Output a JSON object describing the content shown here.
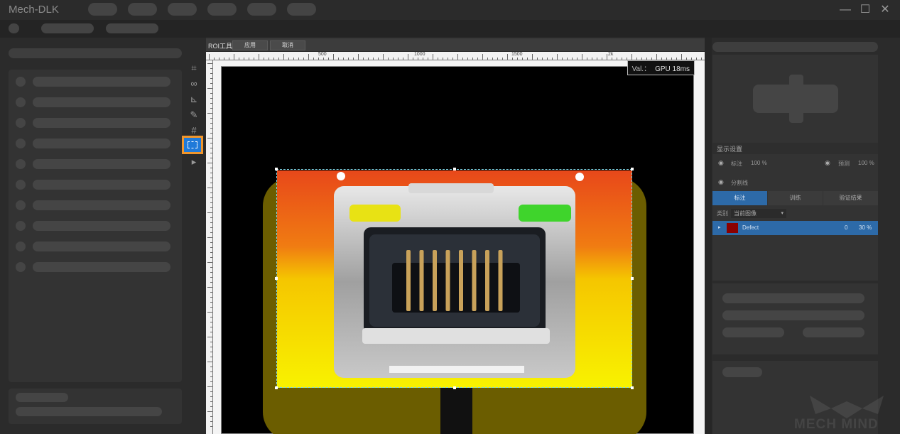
{
  "app": {
    "title": "Mech-DLK",
    "window_controls": [
      "minimize-icon",
      "maximize-icon",
      "close-icon"
    ]
  },
  "canvas": {
    "roi_tool_label": "ROI工具",
    "apply_button": "应用",
    "cancel_button": "取消",
    "ruler_labels": [
      "500",
      "1000",
      "1500",
      "2k"
    ],
    "val_label": "Val.：",
    "val_value": "GPU 18ms"
  },
  "tools": [
    {
      "icon": "crop-icon"
    },
    {
      "icon": "link-icon"
    },
    {
      "icon": "polygon-icon"
    },
    {
      "icon": "eraser-icon"
    },
    {
      "icon": "grid-icon"
    },
    {
      "icon": "roi-select-icon",
      "active": true
    },
    {
      "icon": "play-select-icon"
    }
  ],
  "display_settings": {
    "title": "显示设置",
    "label_text": "标注",
    "label_opacity": "100 %",
    "predict_text": "预测",
    "predict_opacity": "100 %",
    "divider_text": "分割线",
    "tabs": [
      "标注",
      "训练",
      "验证结果"
    ],
    "category_label": "类别",
    "category_select": "当前图像",
    "defect": {
      "name": "Defect",
      "count": "0",
      "percent": "30 %",
      "color": "#8b0000"
    }
  },
  "logo": {
    "text": "MECH MIND"
  },
  "colors": {
    "accent": "#2d6aa8",
    "active_tool_border": "#f0962c",
    "active_tool_bg": "#1f7ad9",
    "roi_border": "#7fd6e6"
  }
}
